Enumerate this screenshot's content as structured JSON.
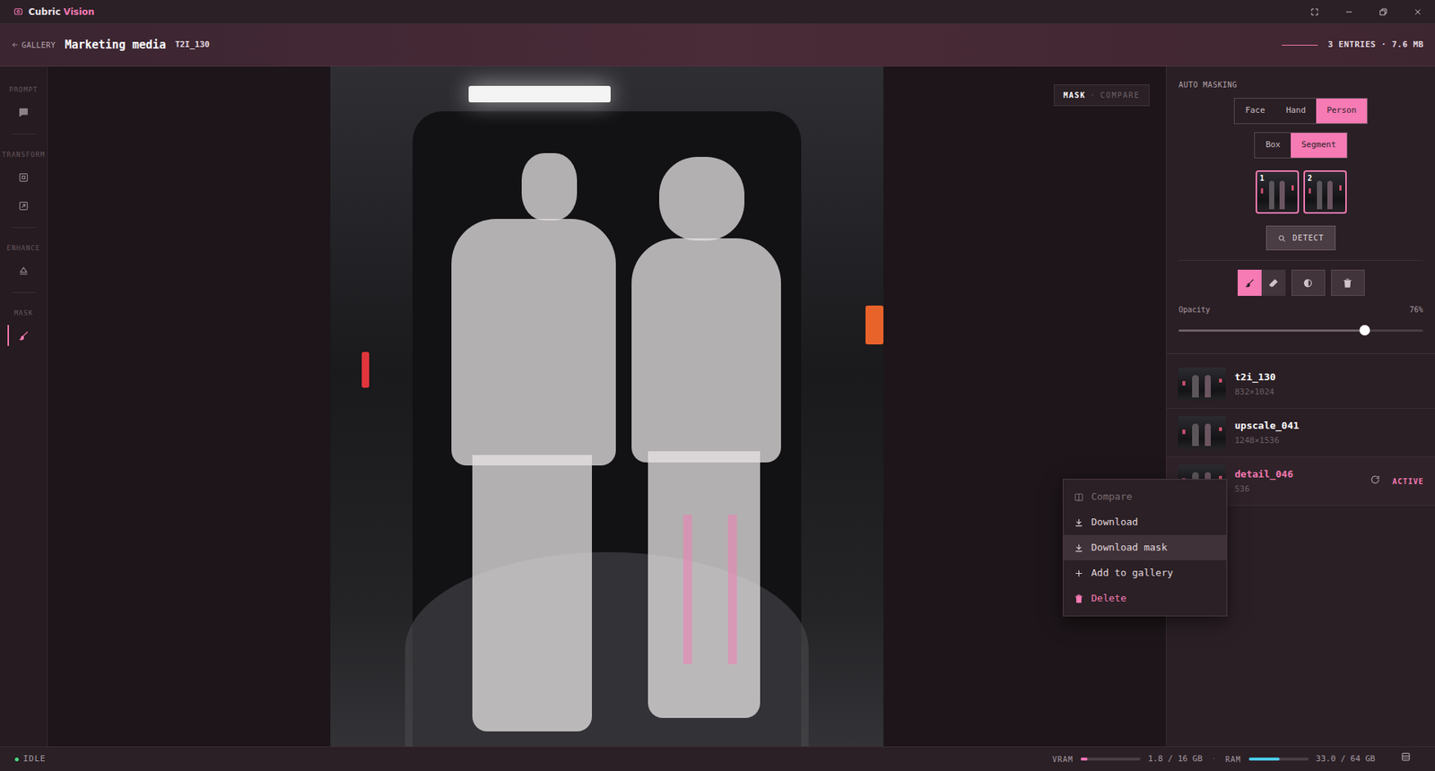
{
  "window": {
    "brand": "Cubric",
    "brand_accent": "Vision"
  },
  "header": {
    "back": "GALLERY",
    "title": "Marketing media",
    "id": "T2I_130",
    "summary": "3 ENTRIES · 7.6 MB"
  },
  "rail": {
    "sections": [
      {
        "label": "PROMPT",
        "items": [
          {
            "kind": "prompt",
            "selected": false
          }
        ]
      },
      {
        "label": "TRANSFORM",
        "items": [
          {
            "kind": "crop",
            "selected": false
          },
          {
            "kind": "resize",
            "selected": false
          }
        ]
      },
      {
        "label": "ENHANCE",
        "items": [
          {
            "kind": "enhance",
            "selected": false
          }
        ]
      },
      {
        "label": "MASK",
        "items": [
          {
            "kind": "mask",
            "selected": true
          }
        ]
      }
    ]
  },
  "canvas": {
    "view_toggle": [
      {
        "label": "MASK",
        "selected": true
      },
      {
        "label": "COMPARE",
        "selected": false
      }
    ],
    "separator": "·"
  },
  "auto_masking": {
    "title": "AUTO MASKING",
    "targets": [
      {
        "label": "Face",
        "selected": false
      },
      {
        "label": "Hand",
        "selected": false
      },
      {
        "label": "Person",
        "selected": true
      }
    ],
    "modes": [
      {
        "label": "Box",
        "selected": false
      },
      {
        "label": "Segment",
        "selected": true
      }
    ],
    "detections": [
      {
        "label": "1",
        "selected": true
      },
      {
        "label": "2",
        "selected": true
      }
    ],
    "detect_button": "DETECT"
  },
  "tools": [
    {
      "kind": "brush",
      "selected": true
    },
    {
      "kind": "eraser",
      "selected": false
    },
    {
      "kind": "invert",
      "selected": false
    },
    {
      "kind": "clear",
      "selected": false
    }
  ],
  "opacity": {
    "label": "Opacity",
    "reading": "76%",
    "level": 0.76
  },
  "entries": [
    {
      "name": "t2i_130",
      "size": "832×1024",
      "active": false
    },
    {
      "name": "upscale_041",
      "size": "1248×1536",
      "active": false
    },
    {
      "name": "detail_046",
      "size": "536",
      "active": true,
      "badge": "ACTIVE"
    }
  ],
  "context_menu": {
    "items": [
      {
        "label": "Compare",
        "kind": "compare",
        "disabled": true,
        "selected": false
      },
      {
        "label": "Download",
        "kind": "download",
        "disabled": false,
        "selected": false
      },
      {
        "label": "Download mask",
        "kind": "download",
        "disabled": false,
        "selected": true
      },
      {
        "label": "Add to gallery",
        "kind": "add",
        "disabled": false,
        "selected": false
      },
      {
        "label": "Delete",
        "kind": "delete",
        "disabled": false,
        "selected": false
      }
    ]
  },
  "status_bar": {
    "state": "IDLE",
    "separator": "·",
    "meters": [
      {
        "label": "VRAM",
        "level": 0.1125,
        "reading": "1.8 / 16 GB",
        "color": "#f472b6"
      },
      {
        "label": "RAM",
        "level": 0.52,
        "reading": "33.0 / 64 GB",
        "color": "#4cc9f0"
      }
    ]
  }
}
